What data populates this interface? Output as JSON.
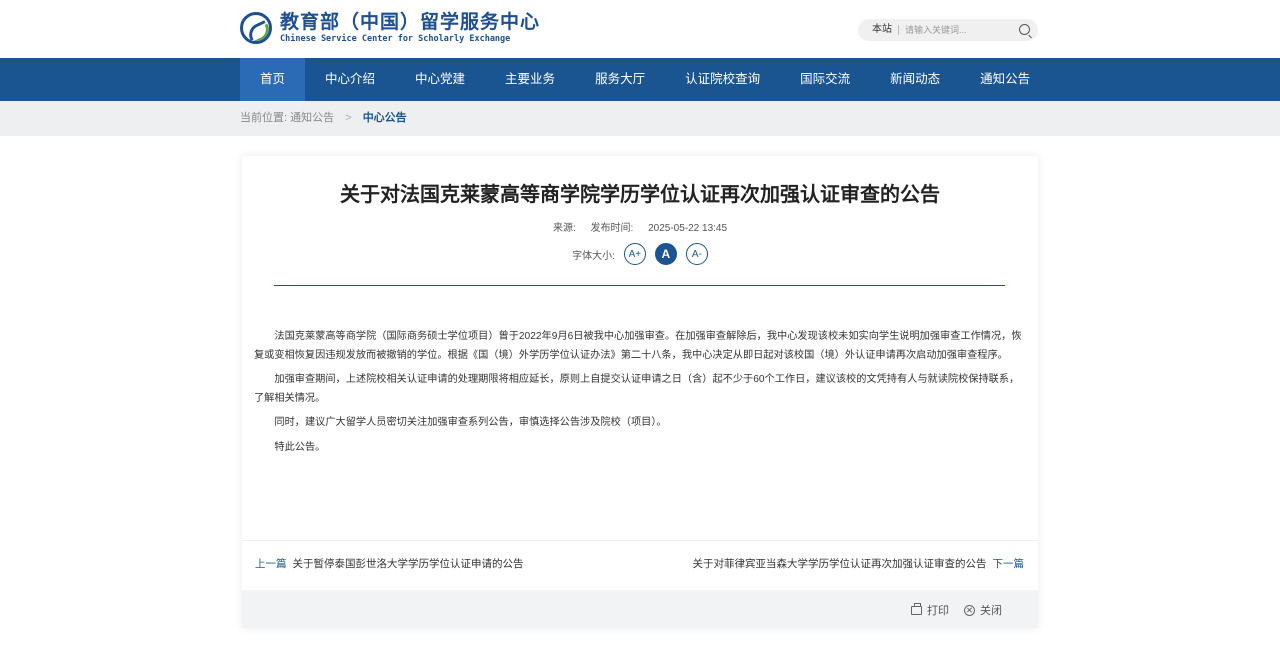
{
  "header": {
    "logo_cn": "教育部（中国）留学服务中心",
    "logo_en": "Chinese Service Center for Scholarly Exchange",
    "search_scope": "本站",
    "search_placeholder": "请输入关键词..."
  },
  "nav": {
    "items": [
      {
        "label": "首页",
        "active": true
      },
      {
        "label": "中心介绍"
      },
      {
        "label": "中心党建"
      },
      {
        "label": "主要业务"
      },
      {
        "label": "服务大厅"
      },
      {
        "label": "认证院校查询"
      },
      {
        "label": "国际交流"
      },
      {
        "label": "新闻动态"
      },
      {
        "label": "通知公告"
      }
    ]
  },
  "breadcrumb": {
    "prefix": "当前位置:",
    "parent": "通知公告",
    "separator": ">",
    "current": "中心公告"
  },
  "article": {
    "title": "关于对法国克莱蒙高等商学院学历学位认证再次加强认证审查的公告",
    "source_label": "来源:",
    "publish_label": "发布时间:",
    "publish_time": "2025-05-22 13:45",
    "fontsize_label": "字体大小:",
    "font_buttons": [
      "A+",
      "A",
      "A-"
    ],
    "paragraphs": [
      "法国克莱蒙高等商学院（国际商务硕士学位项目）曾于2022年9月6日被我中心加强审查。在加强审查解除后，我中心发现该校未如实向学生说明加强审查工作情况，恢复或变相恢复因违规发放而被撤销的学位。根据《国（境）外学历学位认证办法》第二十八条，我中心决定从即日起对该校国（境）外认证申请再次启动加强审查程序。",
      "加强审查期间，上述院校相关认证申请的处理期限将相应延长，原则上自提交认证申请之日（含）起不少于60个工作日，建议该校的文凭持有人与就读院校保持联系，了解相关情况。",
      "同时，建议广大留学人员密切关注加强审查系列公告，审慎选择公告涉及院校（项目）。",
      "特此公告。"
    ]
  },
  "pager": {
    "prev_tag": "上一篇",
    "prev_title": "关于暂停泰国彭世洛大学学历学位认证申请的公告",
    "next_title": "关于对菲律宾亚当森大学学历学位认证再次加强认证审查的公告",
    "next_tag": "下一篇"
  },
  "tools": {
    "print_label": "打印",
    "close_label": "关闭"
  },
  "colors": {
    "nav_bg": "#1b5591",
    "nav_active": "#2b6bb5",
    "accent": "#1b5591"
  }
}
